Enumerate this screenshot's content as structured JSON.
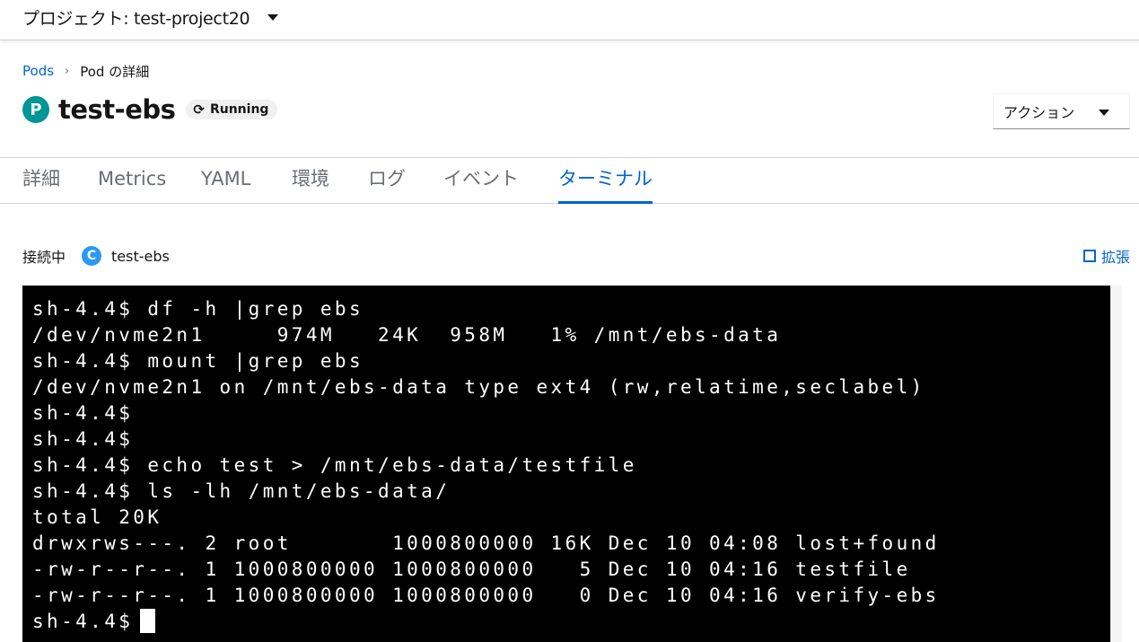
{
  "topbar": {
    "project_label": "プロジェクト: test-project20"
  },
  "breadcrumb": {
    "pods_link": "Pods",
    "current": "Pod の詳細"
  },
  "resource": {
    "badge": "P",
    "name": "test-ebs",
    "status": "Running",
    "status_icon": "sync-icon"
  },
  "actions": {
    "label": "アクション"
  },
  "tabs": [
    {
      "label": "詳細",
      "active": false
    },
    {
      "label": "Metrics",
      "active": false
    },
    {
      "label": "YAML",
      "active": false
    },
    {
      "label": "環境",
      "active": false
    },
    {
      "label": "ログ",
      "active": false
    },
    {
      "label": "イベント",
      "active": false
    },
    {
      "label": "ターミナル",
      "active": true
    }
  ],
  "connection": {
    "label": "接続中",
    "container_badge": "C",
    "container_name": "test-ebs",
    "expand_label": "拡張"
  },
  "terminal": {
    "lines": [
      "sh-4.4$ df -h |grep ebs",
      "/dev/nvme2n1     974M   24K  958M   1% /mnt/ebs-data",
      "sh-4.4$ mount |grep ebs",
      "/dev/nvme2n1 on /mnt/ebs-data type ext4 (rw,relatime,seclabel)",
      "sh-4.4$",
      "sh-4.4$",
      "sh-4.4$ echo test > /mnt/ebs-data/testfile",
      "sh-4.4$ ls -lh /mnt/ebs-data/",
      "total 20K",
      "drwxrws---. 2 root       1000800000 16K Dec 10 04:08 lost+found",
      "-rw-r--r--. 1 1000800000 1000800000   5 Dec 10 04:16 testfile",
      "-rw-r--r--. 1 1000800000 1000800000   0 Dec 10 04:16 verify-ebs"
    ],
    "prompt": "sh-4.4$"
  },
  "colors": {
    "accent": "#0066cc",
    "pod_badge": "#009596",
    "container_badge": "#2b9af3",
    "terminal_bg": "#000000"
  }
}
